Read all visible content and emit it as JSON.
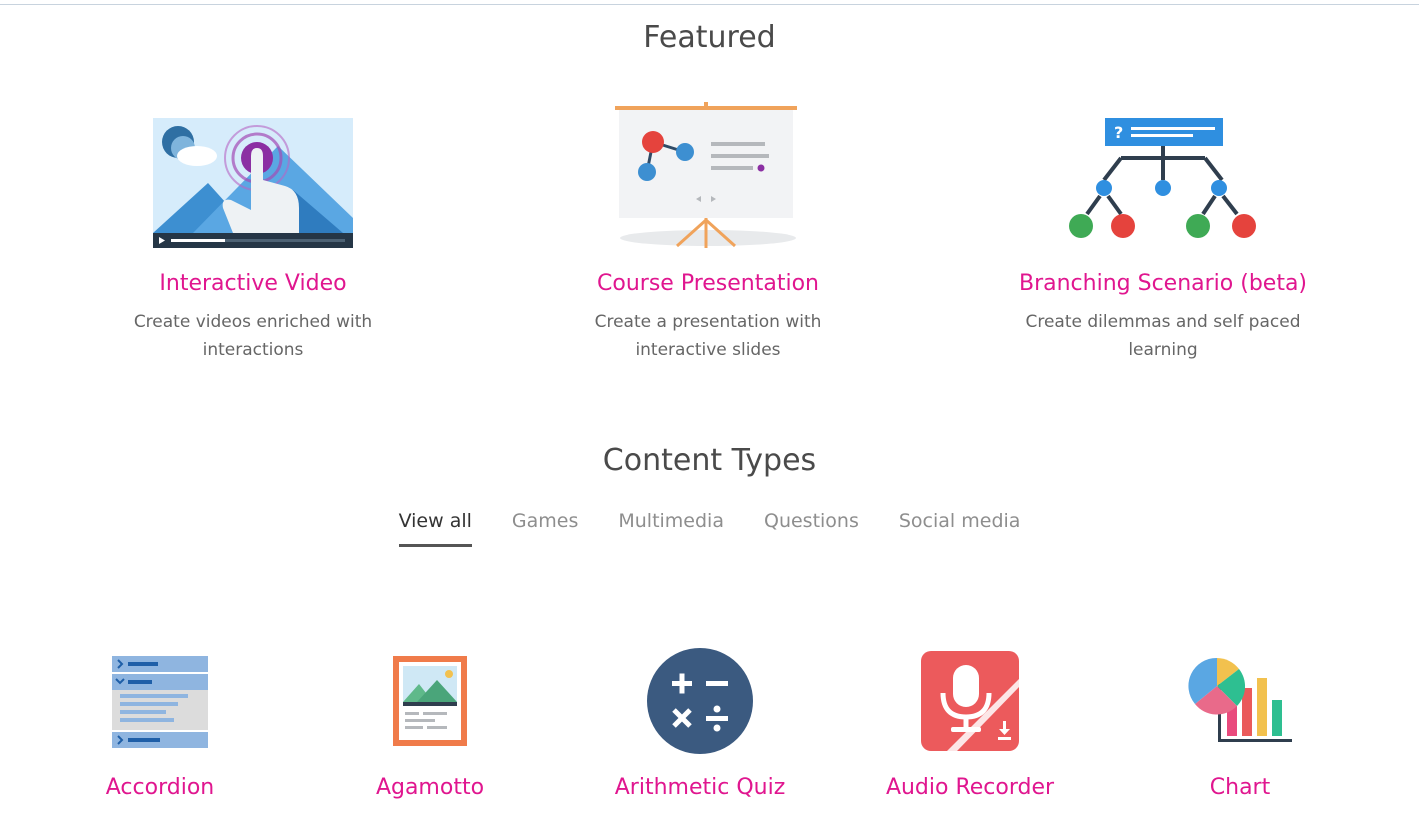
{
  "featured": {
    "title": "Featured",
    "items": [
      {
        "name": "Interactive Video",
        "description": "Create videos enriched with interactions",
        "icon": "interactive-video-icon"
      },
      {
        "name": "Course Presentation",
        "description": "Create a presentation with interactive slides",
        "icon": "course-presentation-icon"
      },
      {
        "name": "Branching Scenario (beta)",
        "description": "Create dilemmas and self paced learning",
        "icon": "branching-scenario-icon"
      }
    ]
  },
  "content_types": {
    "title": "Content Types",
    "tabs": [
      {
        "label": "View all",
        "active": true
      },
      {
        "label": "Games",
        "active": false
      },
      {
        "label": "Multimedia",
        "active": false
      },
      {
        "label": "Questions",
        "active": false
      },
      {
        "label": "Social media",
        "active": false
      }
    ],
    "items": [
      {
        "name": "Accordion",
        "icon": "accordion-icon"
      },
      {
        "name": "Agamotto",
        "icon": "agamotto-icon"
      },
      {
        "name": "Arithmetic Quiz",
        "icon": "arithmetic-quiz-icon"
      },
      {
        "name": "Audio Recorder",
        "icon": "audio-recorder-icon"
      },
      {
        "name": "Chart",
        "icon": "chart-icon"
      }
    ]
  },
  "colors": {
    "accent": "#e0168f",
    "tab_active": "#333333",
    "tab_inactive": "#8e8e8e"
  }
}
